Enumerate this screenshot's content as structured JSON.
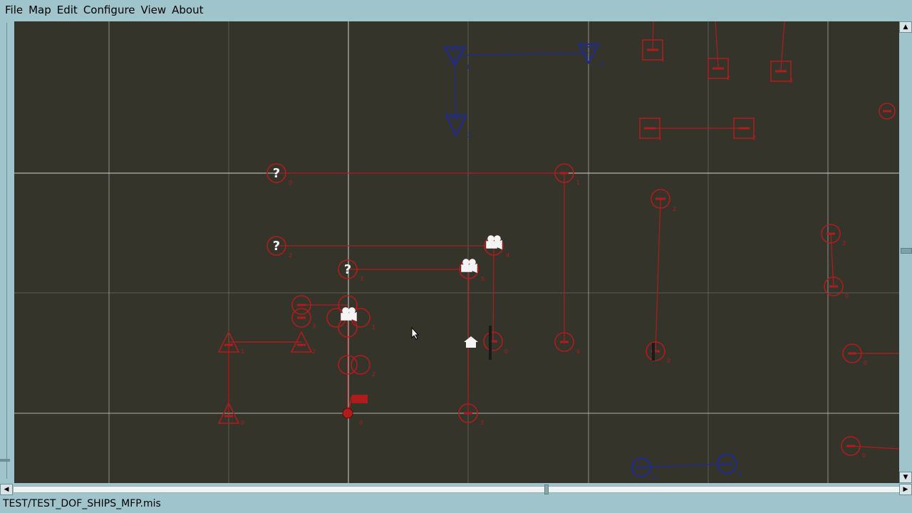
{
  "menu": {
    "items": [
      "File",
      "Map",
      "Edit",
      "Configure",
      "View",
      "About"
    ]
  },
  "status": {
    "mission_path": "TEST/TEST_DOF_SHIPS_MFP.mis"
  },
  "colors": {
    "map_background": "#34342b",
    "red_units": "#b01c1c",
    "blue_units": "#1d2b9a",
    "grid": "#d8d8d8",
    "chrome": "#9fc4cc"
  },
  "map": {
    "grid": true,
    "unit_groups": [
      {
        "side": "blue",
        "kind": "triangle",
        "labels": [
          "1",
          "0",
          "2"
        ]
      },
      {
        "side": "blue",
        "kind": "circle",
        "labels": [
          "0",
          "1"
        ]
      },
      {
        "side": "red",
        "kind": "square",
        "labels": [
          "1",
          "2",
          "3"
        ]
      },
      {
        "side": "red",
        "kind": "circle",
        "labels": [
          "0",
          "1",
          "2",
          "3",
          "4",
          "5",
          "6"
        ]
      },
      {
        "side": "red",
        "kind": "triangle",
        "labels": [
          "0",
          "1",
          "2",
          "3"
        ]
      }
    ]
  }
}
